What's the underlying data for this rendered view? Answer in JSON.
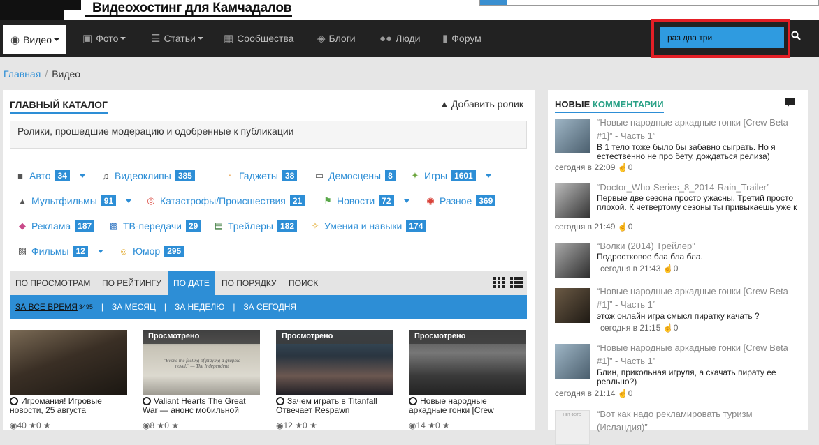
{
  "site": {
    "title": "Видеохостинг для Камчадалов"
  },
  "nav": {
    "items": [
      {
        "label": "Видео",
        "icon": "camera-icon",
        "dropdown": true,
        "active": true
      },
      {
        "label": "Фото",
        "icon": "photo-camera-icon",
        "dropdown": true
      },
      {
        "label": "Статьи",
        "icon": "document-icon",
        "dropdown": true
      },
      {
        "label": "Сообщества",
        "icon": "community-icon",
        "dropdown": false
      },
      {
        "label": "Блоги",
        "icon": "blog-icon",
        "dropdown": false
      },
      {
        "label": "Люди",
        "icon": "people-icon",
        "dropdown": false
      },
      {
        "label": "Форум",
        "icon": "forum-icon",
        "dropdown": false
      }
    ],
    "search_value": "раз два три",
    "search_icon": "search-icon"
  },
  "breadcrumb": {
    "home": "Главная",
    "current": "Видео"
  },
  "catalog": {
    "title": "ГЛАВНЫЙ КАТАЛОГ",
    "add_label": "Добавить ролик",
    "description": "Ролики, прошедшие модерацию и одобренные к публикации",
    "categories": [
      {
        "label": "Авто",
        "count": "34",
        "icon": "car-icon",
        "dropdown": true
      },
      {
        "label": "Видеоклипы",
        "count": "385",
        "icon": "music-icon",
        "dropdown": false
      },
      {
        "label": "Гаджеты",
        "count": "38",
        "icon": "wifi-icon",
        "dropdown": false
      },
      {
        "label": "Демосцены",
        "count": "8",
        "icon": "monitor-icon",
        "dropdown": false
      },
      {
        "label": "Игры",
        "count": "1601",
        "icon": "gamepad-icon",
        "dropdown": true
      },
      {
        "label": "Мультфильмы",
        "count": "91",
        "icon": "penguin-icon",
        "dropdown": true
      },
      {
        "label": "Катастрофы/Происшествия",
        "count": "21",
        "icon": "lifebuoy-icon",
        "dropdown": false
      },
      {
        "label": "Новости",
        "count": "72",
        "icon": "news-icon",
        "dropdown": true
      },
      {
        "label": "Разное",
        "count": "369",
        "icon": "target-icon",
        "dropdown": false
      },
      {
        "label": "Реклама",
        "count": "187",
        "icon": "ads-icon",
        "dropdown": false
      },
      {
        "label": "ТВ-передачи",
        "count": "29",
        "icon": "tv-icon",
        "dropdown": false
      },
      {
        "label": "Трейлеры",
        "count": "182",
        "icon": "film-strip-icon",
        "dropdown": false
      },
      {
        "label": "Умения и навыки",
        "count": "174",
        "icon": "wand-icon",
        "dropdown": false
      },
      {
        "label": "Фильмы",
        "count": "12",
        "icon": "clapper-icon",
        "dropdown": true
      },
      {
        "label": "Юмор",
        "count": "295",
        "icon": "smile-icon",
        "dropdown": false
      }
    ],
    "sort_tabs": [
      "ПО ПРОСМОТРАМ",
      "ПО РЕЙТИНГУ",
      "ПО ДАТЕ",
      "ПО ПОРЯДКУ",
      "ПОИСК"
    ],
    "sort_active": "ПО ДАТЕ",
    "periods": [
      {
        "label": "ЗА ВСЕ ВРЕМЯ",
        "count": "3495",
        "current": true
      },
      {
        "label": "ЗА МЕСЯЦ"
      },
      {
        "label": "ЗА НЕДЕЛЮ"
      },
      {
        "label": "ЗА СЕГОДНЯ"
      }
    ],
    "period_separator": "|",
    "videos": [
      {
        "title": "Игромания! Игровые новости, 25 августа",
        "watched": "",
        "views": "40",
        "rating": "0"
      },
      {
        "title": "Valiant Hearts The Great War — анонс мобильной",
        "watched": "Просмотрено",
        "views": "8",
        "rating": "0",
        "quote": "\"Evoke the feeling of playing a graphic novel.\" — The Independent"
      },
      {
        "title": "Зачем играть в Titanfall Отвечает Respawn",
        "watched": "Просмотрено",
        "views": "12",
        "rating": "0"
      },
      {
        "title": "Новые народные аркадные гонки [Crew",
        "watched": "Просмотрено",
        "views": "14",
        "rating": "0"
      }
    ]
  },
  "comments": {
    "title_part1": "НОВЫЕ",
    "title_part2": "КОММЕНТАРИИ",
    "accent": "#2aa186",
    "items": [
      {
        "topic": "“Новые народные аркадные гонки [Crew Beta #1]” - Часть 1”",
        "text": "В 1 тело тоже было бы забавно сыграть. Но я естественно не про бету, дождаться релиза)",
        "time": "сегодня в 22:09",
        "likes": "0"
      },
      {
        "topic": "“Doctor_Who-Series_8_2014-Rain_Trailer”",
        "text": "Первые две сезона просто ужасны. Третий просто плохой. К четвертому сезоны ты привыкаешь уже к",
        "time": "сегодня в 21:49",
        "likes": "0"
      },
      {
        "topic": "“Волки (2014) Трейлер”",
        "text": "Подростковое бла бла бла.",
        "time": "сегодня в 21:43",
        "likes": "0"
      },
      {
        "topic": "“Новые народные аркадные гонки [Crew Beta #1]” - Часть 1”",
        "text": "этож онлайн игра смысл пиратку качать ?",
        "time": "сегодня в 21:15",
        "likes": "0"
      },
      {
        "topic": "“Новые народные аркадные гонки [Crew Beta #1]” - Часть 1”",
        "text": "Блин, прикольная игруля, а скачать пирату ее реально?)",
        "time": "сегодня в 21:14",
        "likes": "0"
      },
      {
        "topic": "“Вот как надо рекламировать туризм (Исландия)”",
        "text": "",
        "time": "",
        "likes": "",
        "avatar_label": "НЕТ ФОТО"
      }
    ]
  }
}
